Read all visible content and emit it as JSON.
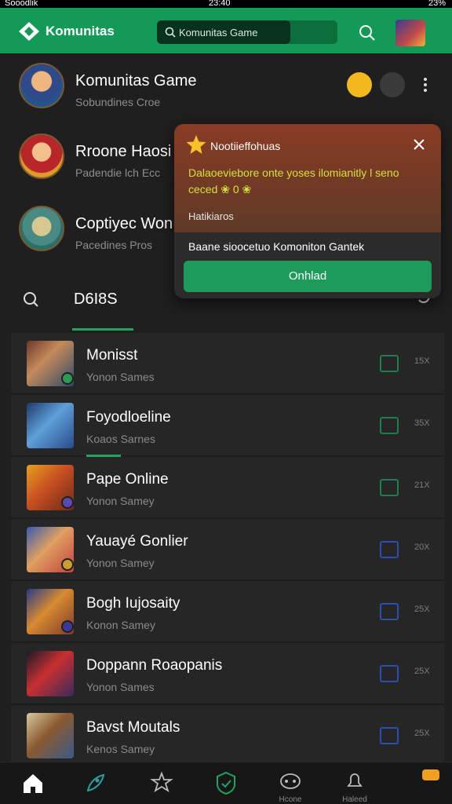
{
  "status_bar": {
    "carrier": "Sooodlik",
    "time": "23:40",
    "battery": "23%"
  },
  "header": {
    "app_name": "Komunitas",
    "search_placeholder": "Komunitas Game"
  },
  "communities": [
    {
      "name": "Komunitas Game",
      "sub": "Sobundines Croe"
    },
    {
      "name": "Rroone Haosi",
      "sub": "Padendie lch Ecc"
    },
    {
      "name": "Coptiyec Won",
      "sub": "Pacedines Pros"
    }
  ],
  "tabs": {
    "active_label": "D6I8S"
  },
  "games": [
    {
      "name": "Monisst",
      "sub": "Yonon Sames",
      "count": "15X"
    },
    {
      "name": "Foyodloeline",
      "sub": "Koaos Sarnes",
      "count": "35X"
    },
    {
      "name": "Pape Online",
      "sub": "Yonon Samey",
      "count": "21X"
    },
    {
      "name": "Yauayé Gonlier",
      "sub": "Yonon Samey",
      "count": "20X"
    },
    {
      "name": "Bogh Iujosaity",
      "sub": "Konon Samey",
      "count": "25X"
    },
    {
      "name": "Doppann Roaopanis",
      "sub": "Yonon Sames",
      "count": "25X"
    },
    {
      "name": "Bavst Moutals",
      "sub": "Kenos Samey",
      "count": "25X"
    }
  ],
  "notification": {
    "title": "Nootiieffohuas",
    "message": "Dalaoeviebore onte yoses ilomianitly l seno ceced ❀ 0 ❀",
    "label": "Hatikiaros",
    "description": "Baane sioocetuo Komoniton Gantek",
    "button": "Onhlad"
  },
  "bottom_nav": [
    {
      "icon": "home-icon",
      "label": ""
    },
    {
      "icon": "rocket-icon",
      "label": ""
    },
    {
      "icon": "star-burst-icon",
      "label": ""
    },
    {
      "icon": "shield-icon",
      "label": ""
    },
    {
      "icon": "gamepad-icon",
      "label": "Hcone"
    },
    {
      "icon": "bell-icon",
      "label": "Haleed"
    }
  ],
  "colors": {
    "accent": "#149a57",
    "bg": "#1f1f1f",
    "popup_header": "#7c3a25",
    "notice_text": "#d2e13a"
  }
}
